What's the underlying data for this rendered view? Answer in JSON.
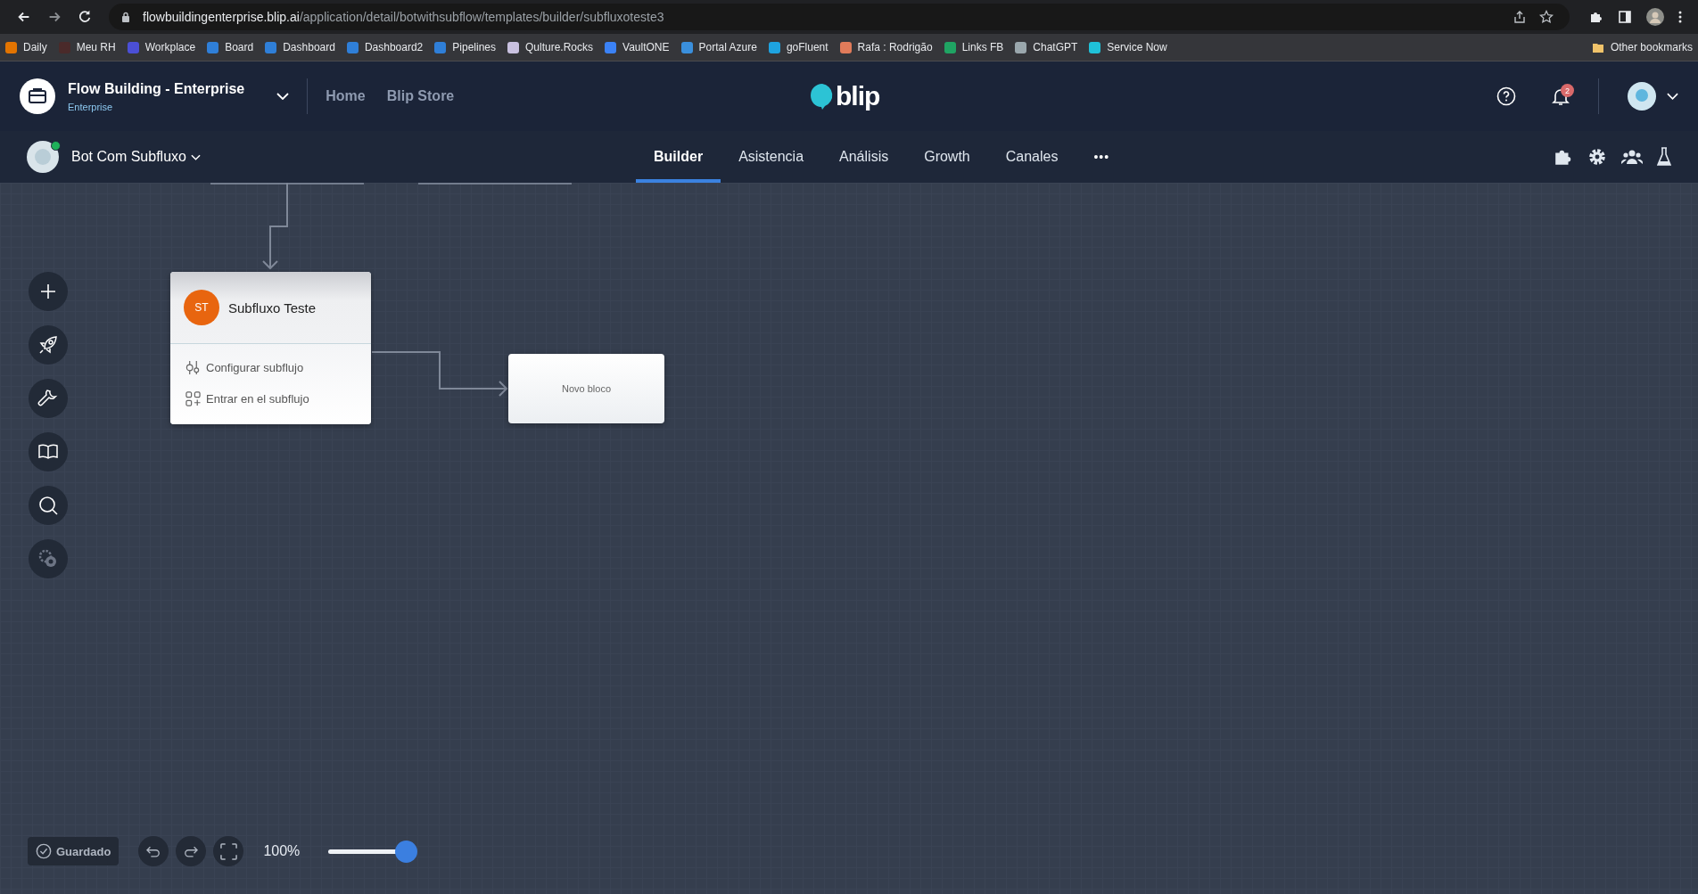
{
  "browser": {
    "url": {
      "host": "flowbuildingenterprise.blip.ai",
      "path": "/application/detail/botwithsubflow/templates/builder/subfluxoteste3"
    },
    "bookmarks": [
      {
        "label": "Daily",
        "color": "#e37400"
      },
      {
        "label": "Meu RH",
        "color": "#4a2a2a"
      },
      {
        "label": "Workplace",
        "color": "#4b4fd6"
      },
      {
        "label": "Board",
        "color": "#2f7fd8"
      },
      {
        "label": "Dashboard",
        "color": "#2f7fd8"
      },
      {
        "label": "Dashboard2",
        "color": "#2f7fd8"
      },
      {
        "label": "Pipelines",
        "color": "#2f7fd8"
      },
      {
        "label": "Qulture.Rocks",
        "color": "#c9c1e0"
      },
      {
        "label": "VaultONE",
        "color": "#3b82f6"
      },
      {
        "label": "Portal Azure",
        "color": "#3a8fdc"
      },
      {
        "label": "goFluent",
        "color": "#1ea3e0"
      },
      {
        "label": "Rafa : Rodrigão",
        "color": "#e07b5a"
      },
      {
        "label": "Links FB",
        "color": "#1fa463"
      },
      {
        "label": "ChatGPT",
        "color": "#9aa7ad"
      },
      {
        "label": "Service Now",
        "color": "#1fc1d8"
      }
    ],
    "other_bookmarks": "Other bookmarks"
  },
  "header": {
    "workspace_title": "Flow Building - Enterprise",
    "workspace_subtitle": "Enterprise",
    "nav": [
      "Home",
      "Blip Store"
    ],
    "logo": "blip",
    "notifications": "2"
  },
  "subnav": {
    "bot_name": "Bot Com Subfluxo",
    "tabs": [
      {
        "label": "Builder",
        "selected": true
      },
      {
        "label": "Asistencia",
        "selected": false
      },
      {
        "label": "Análisis",
        "selected": false
      },
      {
        "label": "Growth",
        "selected": false
      },
      {
        "label": "Canales",
        "selected": false
      }
    ],
    "more": "•••"
  },
  "canvas": {
    "blocks": [
      {
        "kind": "subflow",
        "initials": "ST",
        "title": "Subfluxo Teste",
        "actions": [
          "Configurar subflujo",
          "Entrar en el subflujo"
        ]
      },
      {
        "kind": "block",
        "title": "Novo bloco"
      }
    ]
  },
  "toolbar": {
    "status": "Guardado",
    "zoom": "100%",
    "level": 1
  }
}
